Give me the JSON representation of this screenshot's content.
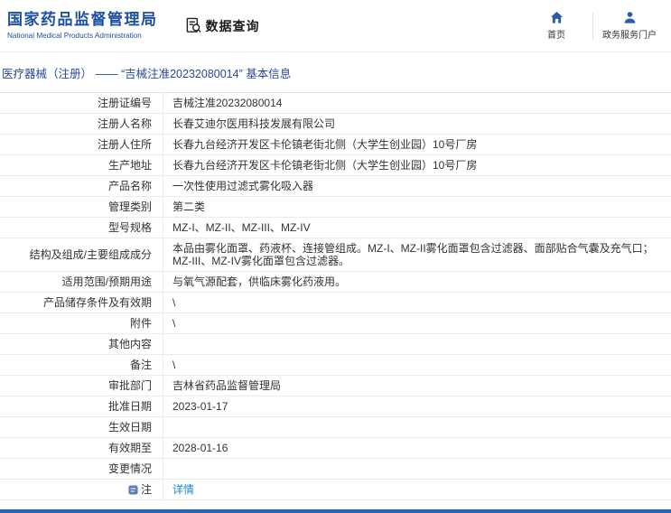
{
  "header": {
    "site_title": "国家药品监督管理局",
    "site_subtitle": "National Medical Products Administration",
    "section_title": "数据查询",
    "nav_home_label": "首页",
    "nav_portal_label": "政务服务门户"
  },
  "breadcrumb": "医疗器械（注册） —— “吉械注准20232080014” 基本信息",
  "detail_table": {
    "rows": [
      {
        "label": "注册证编号",
        "value": "吉械注准20232080014"
      },
      {
        "label": "注册人名称",
        "value": "长春艾迪尔医用科技发展有限公司"
      },
      {
        "label": "注册人住所",
        "value": "长春九台经济开发区卡伦镇老街北侧（大学生创业园）10号厂房"
      },
      {
        "label": "生产地址",
        "value": "长春九台经济开发区卡伦镇老街北侧（大学生创业园）10号厂房"
      },
      {
        "label": "产品名称",
        "value": "一次性使用过滤式雾化吸入器"
      },
      {
        "label": "管理类别",
        "value": "第二类"
      },
      {
        "label": "型号规格",
        "value": "MZ-I、MZ-II、MZ-III、MZ-IV"
      },
      {
        "label": "结构及组成/主要组成成分",
        "value": "本品由雾化面罩、药液杯、连接管组成。MZ-I、MZ-II雾化面罩包含过滤器、面部贴合气囊及充气口；MZ-III、MZ-IV雾化面罩包含过滤器。"
      },
      {
        "label": "适用范围/预期用途",
        "value": "与氧气源配套，供临床雾化药液用。"
      },
      {
        "label": "产品储存条件及有效期",
        "value": "\\"
      },
      {
        "label": "附件",
        "value": "\\"
      },
      {
        "label": "其他内容",
        "value": ""
      },
      {
        "label": "备注",
        "value": "\\"
      },
      {
        "label": "审批部门",
        "value": "吉林省药品监督管理局"
      },
      {
        "label": "批准日期",
        "value": "2023-01-17"
      },
      {
        "label": "生效日期",
        "value": ""
      },
      {
        "label": "有效期至",
        "value": "2028-01-16"
      },
      {
        "label": "变更情况",
        "value": ""
      },
      {
        "label": "注",
        "value": "详情"
      }
    ]
  },
  "colors": {
    "brand_blue": "#1e50a2",
    "nav_icon_blue": "#2a5caa",
    "breadcrumb_blue": "#27489b",
    "link_blue": "#1a86d0",
    "footer_blue": "#2965b0",
    "table_border": "#ebebeb"
  }
}
